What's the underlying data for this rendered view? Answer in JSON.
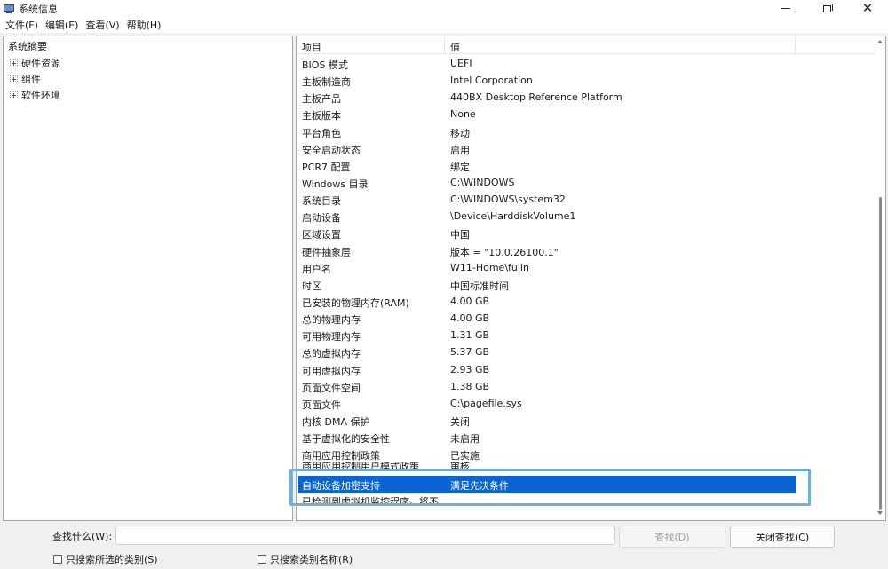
{
  "window": {
    "title": "系统信息"
  },
  "menu": [
    {
      "label": "文件(F)"
    },
    {
      "label": "编辑(E)"
    },
    {
      "label": "查看(V)"
    },
    {
      "label": "帮助(H)"
    }
  ],
  "tree": {
    "root": "系统摘要",
    "children": [
      {
        "label": "硬件资源"
      },
      {
        "label": "组件"
      },
      {
        "label": "软件环境"
      }
    ]
  },
  "table": {
    "headers": {
      "item": "项目",
      "value": "值"
    },
    "rows": [
      {
        "item": "BIOS 模式",
        "value": "UEFI"
      },
      {
        "item": "主板制造商",
        "value": "Intel Corporation"
      },
      {
        "item": "主板产品",
        "value": "440BX Desktop Reference Platform"
      },
      {
        "item": "主板版本",
        "value": "None"
      },
      {
        "item": "平台角色",
        "value": "移动"
      },
      {
        "item": "安全启动状态",
        "value": "启用"
      },
      {
        "item": "PCR7 配置",
        "value": "绑定"
      },
      {
        "item": "Windows 目录",
        "value": "C:\\WINDOWS"
      },
      {
        "item": "系统目录",
        "value": "C:\\WINDOWS\\system32"
      },
      {
        "item": "启动设备",
        "value": "\\Device\\HarddiskVolume1"
      },
      {
        "item": "区域设置",
        "value": "中国"
      },
      {
        "item": "硬件抽象层",
        "value": "版本 = \"10.0.26100.1\""
      },
      {
        "item": "用户名",
        "value": "W11-Home\\fulin"
      },
      {
        "item": "时区",
        "value": "中国标准时间"
      },
      {
        "item": "已安装的物理内存(RAM)",
        "value": "4.00 GB"
      },
      {
        "item": "总的物理内存",
        "value": "4.00 GB"
      },
      {
        "item": "可用物理内存",
        "value": "1.31 GB"
      },
      {
        "item": "总的虚拟内存",
        "value": "5.37 GB"
      },
      {
        "item": "可用虚拟内存",
        "value": "2.93 GB"
      },
      {
        "item": "页面文件空间",
        "value": "1.38 GB"
      },
      {
        "item": "页面文件",
        "value": "C:\\pagefile.sys"
      },
      {
        "item": "内核 DMA 保护",
        "value": "关闭"
      },
      {
        "item": "基于虚拟化的安全性",
        "value": "未启用"
      },
      {
        "item": "商用应用控制政策",
        "value": "已实施"
      },
      {
        "item": "商用应用控制用户模式政策",
        "value": "审核"
      },
      {
        "item": "自动设备加密支持",
        "value": "满足先决条件"
      },
      {
        "item": "已检测到虚拟机监控程序。将不...",
        "value": ""
      }
    ]
  },
  "find": {
    "label": "查找什么(W):",
    "value": "",
    "find_button": "查找(D)",
    "close_button": "关闭查找(C)",
    "option_selected_category": "只搜索所选的类别(S)",
    "option_category_names": "只搜索类别名称(R)"
  },
  "colors": {
    "selection": "#0a64d4",
    "highlight_box": "#6fb0dc"
  }
}
